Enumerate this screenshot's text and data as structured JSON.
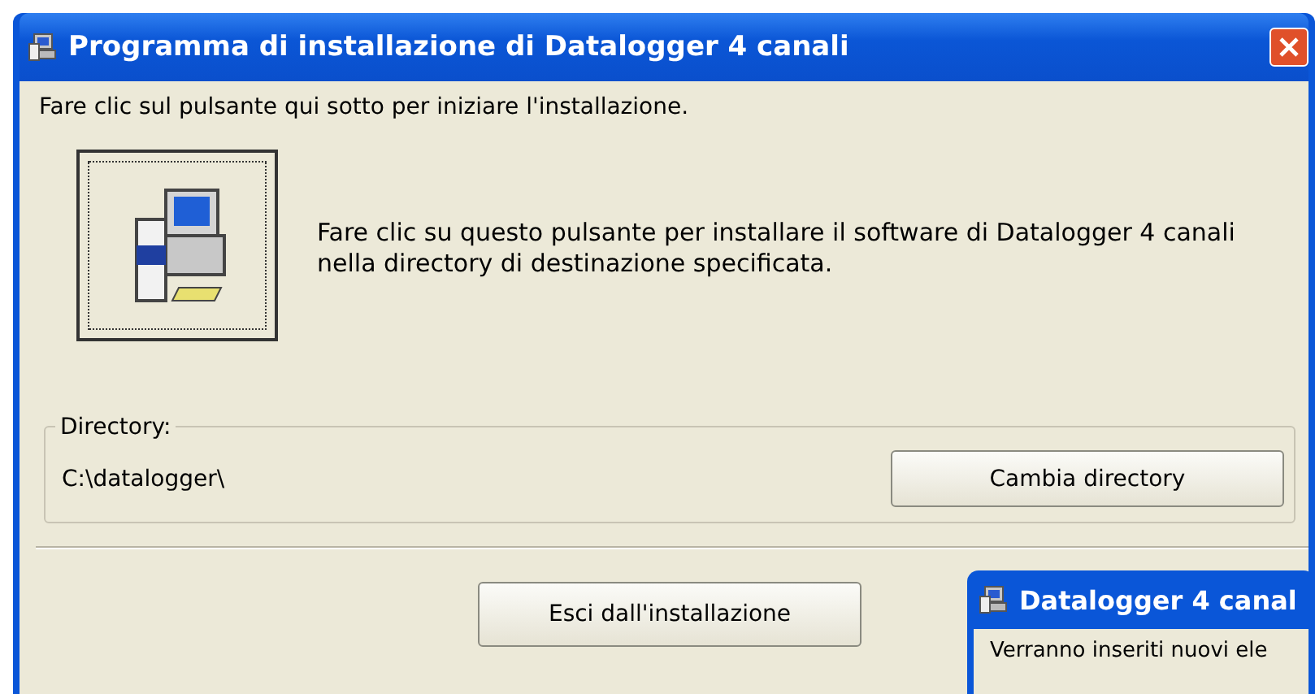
{
  "window": {
    "title": "Programma di installazione di Datalogger 4 canali"
  },
  "instruction": "Fare clic sul pulsante qui sotto per iniziare l'installazione.",
  "install_description": "Fare clic su questo pulsante per installare il software di Datalogger 4 canali nella directory di destinazione specificata.",
  "directory": {
    "label": "Directory:",
    "path": "C:\\datalogger\\",
    "button": "Cambia directory"
  },
  "exit_button": "Esci dall'installazione",
  "second_window": {
    "title": "Datalogger 4 canal",
    "text": "Verranno inseriti nuovi ele"
  }
}
